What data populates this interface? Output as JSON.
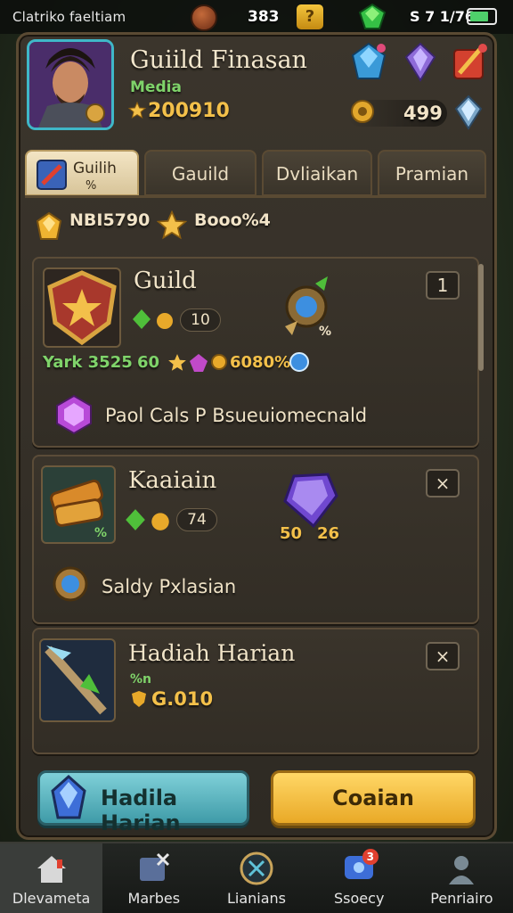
{
  "status_bar": {
    "title": "Clatriko faeltiam",
    "center_value": "383",
    "question": "?",
    "right_value": "S 7 1/76",
    "battery_level": 0.75
  },
  "header": {
    "guild_name": "Guiild Finasan",
    "subtitle": "Media",
    "score": "200910",
    "resource_value": "499"
  },
  "tabs": [
    {
      "label": "Guilih",
      "sub": "%",
      "active": true
    },
    {
      "label": "Gauild",
      "active": false
    },
    {
      "label": "Dvliaikan",
      "active": false
    },
    {
      "label": "Pramian",
      "active": false
    }
  ],
  "stats": {
    "left": "NBI5790",
    "right": "Booo%4"
  },
  "cards": [
    {
      "title": "Guild",
      "button": "1",
      "pill": "10",
      "green_text": "Yark 3525",
      "green_num": "60",
      "gold_text": "6080%",
      "orb_mark": "%",
      "description": "Paol Cals P Bsueuiomecnald"
    },
    {
      "title": "Kaaiain",
      "button": "×",
      "pill": "74",
      "thumb_mark": "%",
      "value_a": "50",
      "value_b": "26",
      "description": "Saldy Pxlasian"
    },
    {
      "title": "Hadiah Harian",
      "button": "×",
      "sub": "%n",
      "value": "G.010"
    }
  ],
  "buttons": {
    "primary": "Hadila Harian",
    "secondary": "Coaian"
  },
  "nav": [
    {
      "label": "Dlevameta",
      "icon": "home-icon",
      "active": true
    },
    {
      "label": "Marbes",
      "icon": "map-icon",
      "active": false
    },
    {
      "label": "Lianians",
      "icon": "swords-icon",
      "active": false
    },
    {
      "label": "Ssoecy",
      "icon": "chat-icon",
      "active": false,
      "badge": "3"
    },
    {
      "label": "Penriairo",
      "icon": "profile-icon",
      "active": false
    }
  ],
  "colors": {
    "accent_gold": "#f3c04a",
    "accent_green": "#7fd36a",
    "accent_teal": "#3fb7c8"
  }
}
